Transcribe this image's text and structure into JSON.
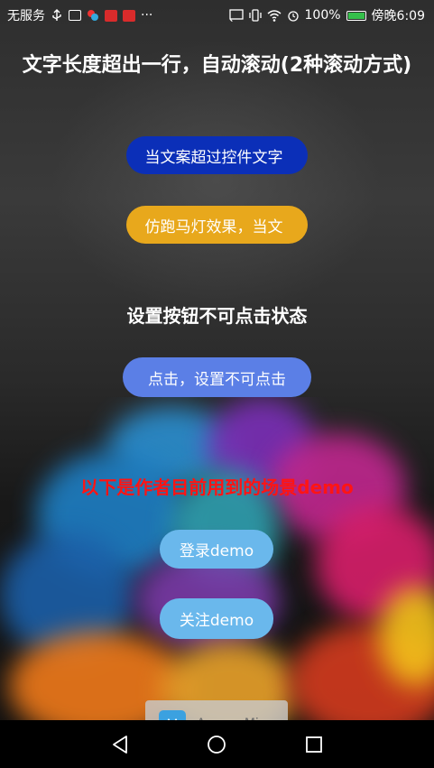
{
  "status_bar": {
    "carrier": "无服务",
    "battery_percent": "100%",
    "time": "傍晚6:09",
    "more": "···"
  },
  "header": {
    "title": "文字长度超出一行，自动滚动(2种滚动方式)"
  },
  "marquee": {
    "button1_label": "当文案超过控件文字",
    "button2_label": "仿跑马灯效果，当文"
  },
  "disable_section": {
    "title": "设置按钮不可点击状态",
    "button_label": "点击，设置不可点击"
  },
  "demo_section": {
    "heading": "以下是作者目前用到的场景demo",
    "login_label": "登录demo",
    "follow_label": "关注demo"
  },
  "overlay": {
    "app_name": "ApowerMirror"
  },
  "colors": {
    "marquee1_bg": "#0b2fb8",
    "marquee2_bg": "#e8a81c",
    "disable_bg": "#5b7fe6",
    "demo_bg": "#6ab8ec",
    "heading_red": "#ff1414"
  },
  "icons": {
    "nav": [
      "back-icon",
      "home-icon",
      "recent-apps-icon"
    ],
    "status": [
      "usb-icon",
      "gallery-icon",
      "app-icon",
      "huawei-icon",
      "cast-icon",
      "vibrate-icon",
      "wifi-icon",
      "alarm-icon",
      "battery-icon"
    ]
  }
}
